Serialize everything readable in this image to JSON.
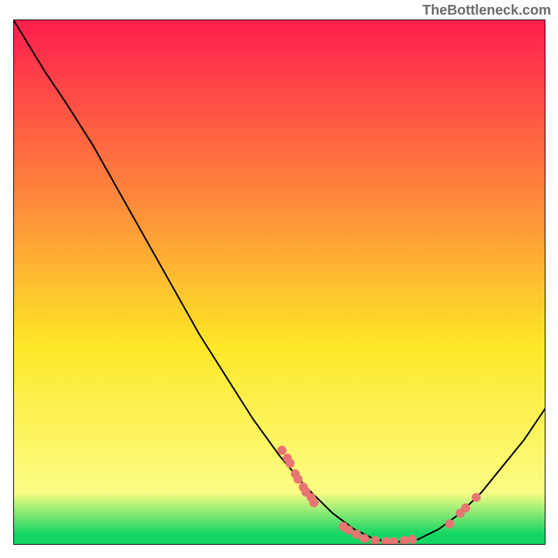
{
  "watermark": "TheBottleneck.com",
  "chart_data": {
    "type": "line",
    "title": "",
    "xlabel": "",
    "ylabel": "",
    "xlim": [
      0,
      100
    ],
    "ylim": [
      0,
      100
    ],
    "background_gradient": {
      "top": "#ff1e4e",
      "mid1": "#ff8b3b",
      "mid2": "#fde727",
      "mid3": "#fbfd84",
      "bottom": "#13d664"
    },
    "curve": [
      {
        "x": 0,
        "y": 100
      },
      {
        "x": 3,
        "y": 95
      },
      {
        "x": 6,
        "y": 90
      },
      {
        "x": 10,
        "y": 84
      },
      {
        "x": 15,
        "y": 76
      },
      {
        "x": 20,
        "y": 67
      },
      {
        "x": 25,
        "y": 58
      },
      {
        "x": 30,
        "y": 49
      },
      {
        "x": 35,
        "y": 40
      },
      {
        "x": 40,
        "y": 32
      },
      {
        "x": 45,
        "y": 24
      },
      {
        "x": 50,
        "y": 17
      },
      {
        "x": 55,
        "y": 11
      },
      {
        "x": 60,
        "y": 6
      },
      {
        "x": 64,
        "y": 3
      },
      {
        "x": 68,
        "y": 1
      },
      {
        "x": 72,
        "y": 0.5
      },
      {
        "x": 76,
        "y": 1
      },
      {
        "x": 80,
        "y": 3
      },
      {
        "x": 84,
        "y": 6
      },
      {
        "x": 88,
        "y": 10
      },
      {
        "x": 92,
        "y": 15
      },
      {
        "x": 96,
        "y": 20
      },
      {
        "x": 100,
        "y": 26
      }
    ],
    "scatter": [
      {
        "x": 50.5,
        "y": 18.0
      },
      {
        "x": 51.5,
        "y": 16.5
      },
      {
        "x": 52.0,
        "y": 15.5
      },
      {
        "x": 53.0,
        "y": 13.5
      },
      {
        "x": 53.5,
        "y": 12.5
      },
      {
        "x": 54.5,
        "y": 11.0
      },
      {
        "x": 55.0,
        "y": 10.0
      },
      {
        "x": 56.0,
        "y": 9.0
      },
      {
        "x": 56.5,
        "y": 8.0
      },
      {
        "x": 62.0,
        "y": 3.5
      },
      {
        "x": 63.0,
        "y": 2.8
      },
      {
        "x": 64.5,
        "y": 2.0
      },
      {
        "x": 66.0,
        "y": 1.2
      },
      {
        "x": 68.0,
        "y": 0.8
      },
      {
        "x": 70.0,
        "y": 0.6
      },
      {
        "x": 71.5,
        "y": 0.6
      },
      {
        "x": 73.5,
        "y": 0.8
      },
      {
        "x": 75.0,
        "y": 1.0
      },
      {
        "x": 82.0,
        "y": 4.0
      },
      {
        "x": 84.0,
        "y": 6.0
      },
      {
        "x": 85.0,
        "y": 7.0
      },
      {
        "x": 87.0,
        "y": 9.0
      }
    ],
    "scatter_color": "#e77572",
    "curve_color": "#000000"
  }
}
